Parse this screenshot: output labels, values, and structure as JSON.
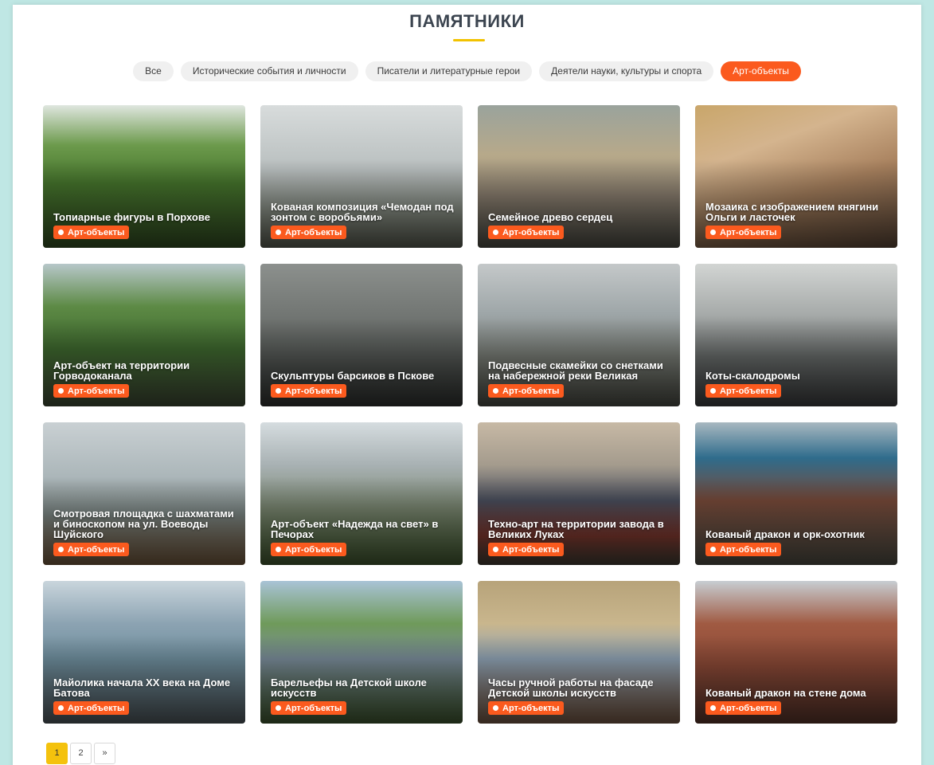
{
  "section_title": "ПАМЯТНИКИ",
  "filters": [
    {
      "label": "Все",
      "active": false
    },
    {
      "label": "Исторические события и личности",
      "active": false
    },
    {
      "label": "Писатели и литературные герои",
      "active": false
    },
    {
      "label": "Деятели науки, культуры и спорта",
      "active": false
    },
    {
      "label": "Арт-объекты",
      "active": true
    }
  ],
  "badge_label": "Арт-объекты",
  "cards": [
    {
      "title": "Топиарные фигуры в Порхове",
      "category": "Арт-объекты"
    },
    {
      "title": "Кованая композиция «Чемодан под зонтом с воробьями»",
      "category": "Арт-объекты"
    },
    {
      "title": "Семейное древо сердец",
      "category": "Арт-объекты"
    },
    {
      "title": "Мозаика с изображением княгини Ольги и ласточек",
      "category": "Арт-объекты"
    },
    {
      "title": "Арт-объект на территории Горводоканала",
      "category": "Арт-объекты"
    },
    {
      "title": "Скульптуры барсиков в Пскове",
      "category": "Арт-объекты"
    },
    {
      "title": "Подвесные скамейки со снетками на набережной реки Великая",
      "category": "Арт-объекты"
    },
    {
      "title": "Коты-скалодромы",
      "category": "Арт-объекты"
    },
    {
      "title": "Смотровая площадка с шахматами и биноскопом на ул. Воеводы Шуйского",
      "category": "Арт-объекты"
    },
    {
      "title": "Арт-объект «Надежда на свет» в Печорах",
      "category": "Арт-объекты"
    },
    {
      "title": "Техно-арт на территории завода в Великих Луках",
      "category": "Арт-объекты"
    },
    {
      "title": "Кованый дракон и орк-охотник",
      "category": "Арт-объекты"
    },
    {
      "title": "Майолика начала XX века на Доме Батова",
      "category": "Арт-объекты"
    },
    {
      "title": "Барельефы на Детской школе искусств",
      "category": "Арт-объекты"
    },
    {
      "title": "Часы ручной работы на фасаде Детской школы искусств",
      "category": "Арт-объекты"
    },
    {
      "title": "Кованый дракон на стене дома",
      "category": "Арт-объекты"
    }
  ],
  "pagination": {
    "pages": [
      "1",
      "2"
    ],
    "current": "1",
    "next": "»"
  },
  "colors": {
    "accent": "#fb5a1e",
    "title_underline": "#f2c200",
    "page_current": "#f4c20d"
  }
}
